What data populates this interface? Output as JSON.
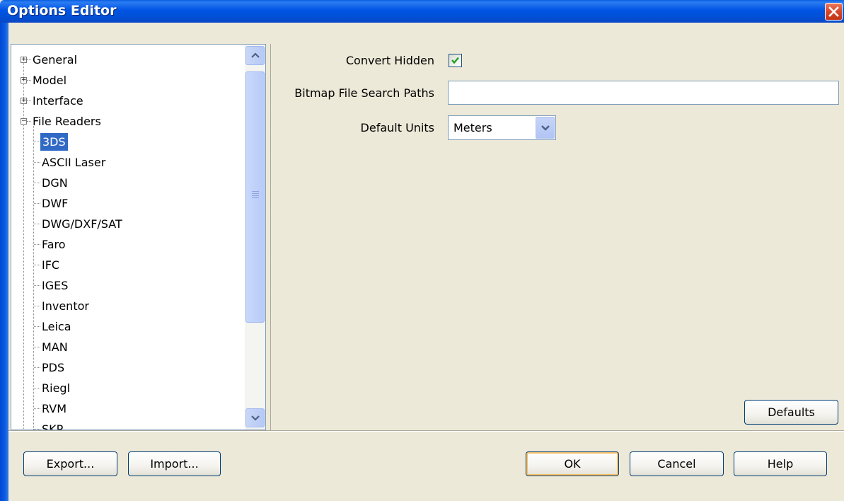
{
  "window": {
    "title": "Options Editor"
  },
  "tree": {
    "top_items": [
      {
        "label": "General",
        "expander": "+"
      },
      {
        "label": "Model",
        "expander": "+"
      },
      {
        "label": "Interface",
        "expander": "+"
      },
      {
        "label": "File Readers",
        "expander": "−"
      }
    ],
    "children": [
      {
        "label": "3DS",
        "selected": true
      },
      {
        "label": "ASCII Laser"
      },
      {
        "label": "DGN"
      },
      {
        "label": "DWF"
      },
      {
        "label": "DWG/DXF/SAT"
      },
      {
        "label": "Faro"
      },
      {
        "label": "IFC"
      },
      {
        "label": "IGES"
      },
      {
        "label": "Inventor"
      },
      {
        "label": "Leica"
      },
      {
        "label": "MAN"
      },
      {
        "label": "PDS"
      },
      {
        "label": "Riegl"
      },
      {
        "label": "RVM"
      },
      {
        "label": "SKP"
      }
    ]
  },
  "settings": {
    "convert_hidden": {
      "label": "Convert Hidden",
      "checked": true
    },
    "bitmap_paths": {
      "label": "Bitmap File Search Paths",
      "value": ""
    },
    "default_units": {
      "label": "Default Units",
      "value": "Meters"
    }
  },
  "buttons": {
    "defaults": "Defaults",
    "export": "Export...",
    "import": "Import...",
    "ok": "OK",
    "cancel": "Cancel",
    "help": "Help"
  },
  "colors": {
    "title_bar": "#0054e3",
    "selection": "#316ac5",
    "dialog_bg": "#ece9d8",
    "check": "#21a121"
  },
  "icons": [
    "close-icon",
    "scroll-up-icon",
    "scroll-down-icon",
    "checkmark-icon",
    "dropdown-arrow-icon",
    "expand-icon",
    "collapse-icon"
  ]
}
